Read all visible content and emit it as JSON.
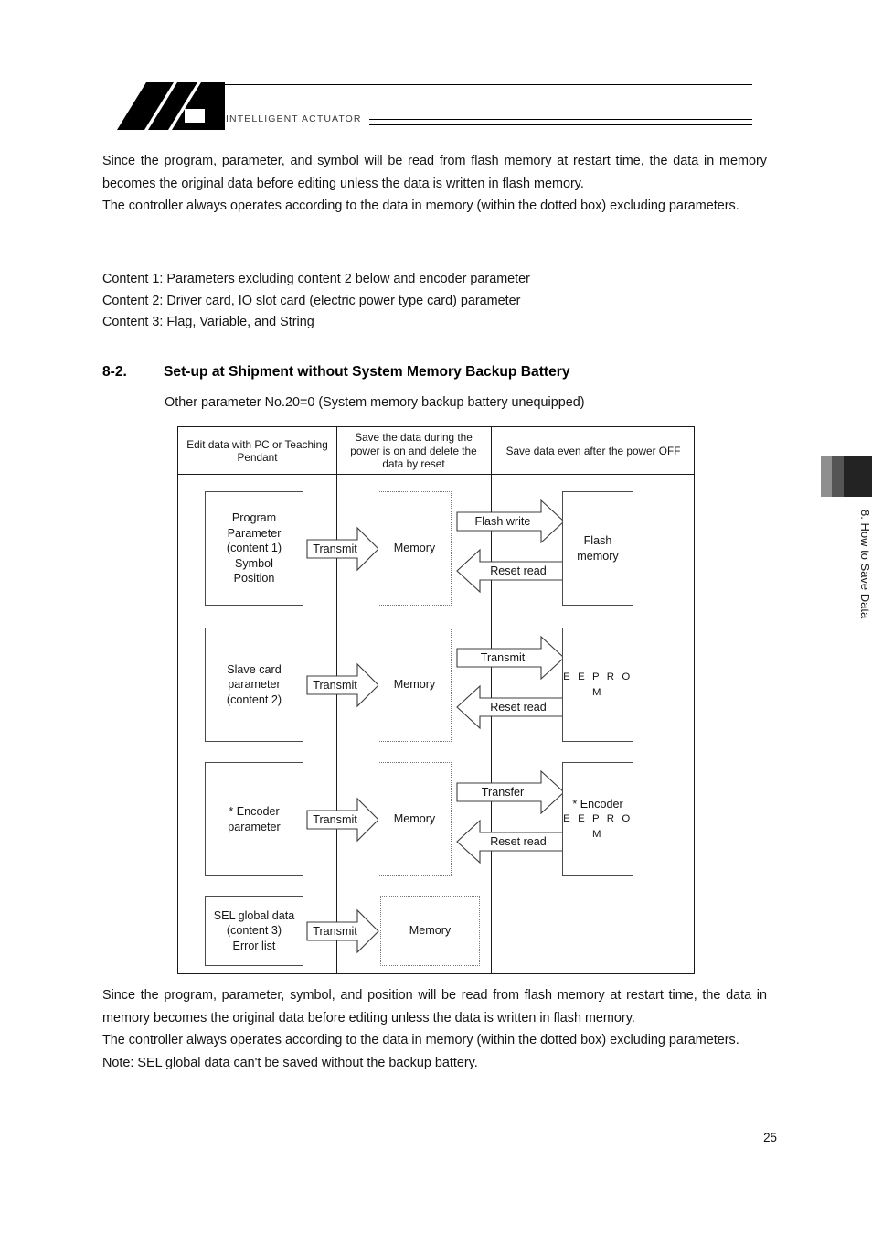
{
  "header": {
    "logo_wordmark": "INTELLIGENT ACTUATOR"
  },
  "intro_paragraph": {
    "text": "Since the program, parameter, and symbol will be read from flash memory at restart time, the data in memory becomes the original data before editing unless the data is written in flash memory.",
    "line2": "The controller always operates according to the data in memory (within the dotted box) excluding parameters."
  },
  "content_list": {
    "item1": "Content 1: Parameters excluding content 2 below and encoder parameter",
    "item2": "Content 2: Driver card, IO slot card (electric power type card) parameter",
    "item3": "Content 3: Flag, Variable, and String"
  },
  "section": {
    "number": "8-2.",
    "title": "Set-up at Shipment without System Memory Backup Battery",
    "subtitle": "Other parameter No.20=0 (System memory backup battery unequipped)"
  },
  "diagram": {
    "headers": [
      "Edit data with PC or Teaching Pendant",
      "Save the data during the power is on and delete the data by reset",
      "Save data even after the power OFF"
    ],
    "rows": [
      {
        "source": "Program Parameter (content 1) Symbol Position",
        "transmit": "Transmit",
        "memory": "Memory",
        "write_arrow": "Flash write",
        "read_arrow": "Reset read",
        "target": "Flash memory"
      },
      {
        "source": "Slave card parameter (content 2)",
        "transmit": "Transmit",
        "memory": "Memory",
        "write_arrow": "Transmit",
        "read_arrow": "Reset read",
        "target": "E E P R O M"
      },
      {
        "source": "* Encoder parameter",
        "transmit": "Transmit",
        "memory": "Memory",
        "write_arrow": "Transfer",
        "read_arrow": "Reset read",
        "target_line1": "* Encoder",
        "target_line2": "E E P R O M"
      },
      {
        "source": "SEL global data (content 3) Error list",
        "transmit": "Transmit",
        "memory": "Memory"
      }
    ]
  },
  "side_tab": {
    "label": "8. How to Save Data"
  },
  "outro_paragraph": {
    "text": "Since the program, parameter, symbol, and position will be read from flash memory at restart time, the data in memory becomes the original data before editing unless the data is written in flash memory.",
    "line2": "The controller always operates according to the data in memory (within the dotted box) excluding parameters.",
    "note": "Note: SEL global data can't be saved without the backup battery."
  },
  "footer": {
    "page_number": "25"
  }
}
